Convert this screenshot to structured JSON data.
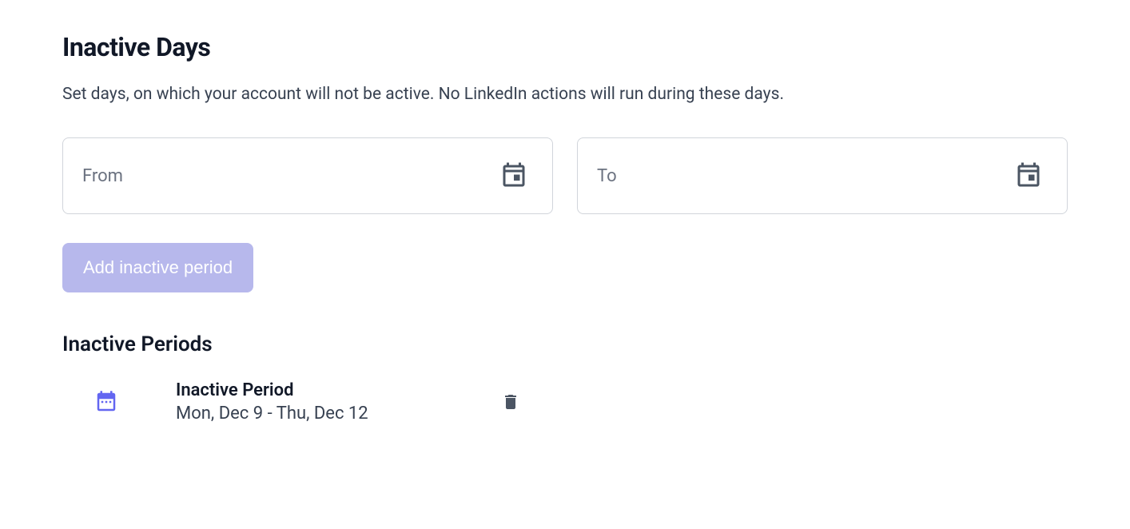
{
  "header": {
    "title": "Inactive Days",
    "description": "Set days, on which your account will not be active. No LinkedIn actions will run during these days."
  },
  "fields": {
    "from": {
      "label": "From",
      "value": ""
    },
    "to": {
      "label": "To",
      "value": ""
    }
  },
  "actions": {
    "add_label": "Add inactive period"
  },
  "periods": {
    "title": "Inactive Periods",
    "items": [
      {
        "label": "Inactive Period",
        "range": "Mon, Dec 9 - Thu, Dec 12"
      }
    ]
  }
}
